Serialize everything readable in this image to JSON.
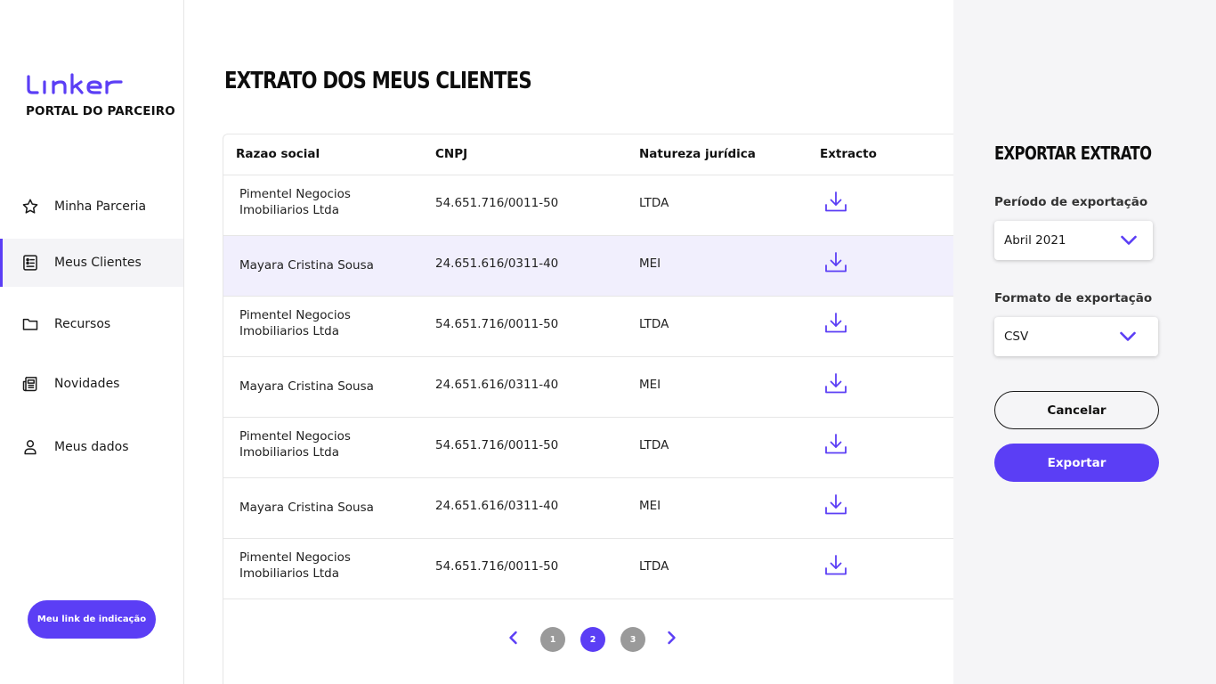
{
  "sidebar": {
    "logo_text": "linker",
    "portal_label": "PORTAL DO PARCEIRO",
    "items": [
      {
        "label": "Minha Parceria",
        "icon": "star-icon"
      },
      {
        "label": "Meus Clientes",
        "icon": "client-list-icon",
        "active": true
      },
      {
        "label": "Recursos",
        "icon": "folder-icon"
      },
      {
        "label": "Novidades",
        "icon": "newspaper-icon"
      },
      {
        "label": "Meus dados",
        "icon": "user-icon"
      }
    ],
    "referral_button": "Meu link de indicação"
  },
  "main": {
    "title": "EXTRATO DOS MEUS CLIENTES",
    "table": {
      "headers": [
        "Razao social",
        "CNPJ",
        "Natureza jurídica",
        "Extracto"
      ],
      "rows": [
        {
          "name": "Pimentel Negocios Imobiliarios Ltda",
          "cnpj": "54.651.716/0011-50",
          "nature": "LTDA"
        },
        {
          "name": "Mayara Cristina Sousa",
          "cnpj": "24.651.616/0311-40",
          "nature": "MEI"
        },
        {
          "name": "Pimentel Negocios Imobiliarios Ltda",
          "cnpj": "54.651.716/0011-50",
          "nature": "LTDA"
        },
        {
          "name": "Mayara Cristina Sousa",
          "cnpj": "24.651.616/0311-40",
          "nature": "MEI"
        },
        {
          "name": "Pimentel Negocios Imobiliarios Ltda",
          "cnpj": "54.651.716/0011-50",
          "nature": "LTDA"
        },
        {
          "name": "Mayara Cristina Sousa",
          "cnpj": "24.651.616/0311-40",
          "nature": "MEI"
        },
        {
          "name": "Pimentel Negocios Imobiliarios Ltda",
          "cnpj": "54.651.716/0011-50",
          "nature": "LTDA"
        }
      ]
    },
    "pagination": {
      "pages": [
        "1",
        "2",
        "3"
      ],
      "current": "2"
    }
  },
  "export_panel": {
    "title": "EXPORTAR EXTRATO",
    "period_label": "Período de exportação",
    "period_value": "Abril 2021",
    "format_label": "Formato de exportação",
    "format_value": "CSV",
    "cancel_label": "Cancelar",
    "export_label": "Exportar"
  },
  "colors": {
    "accent": "#5b3ef5",
    "row_highlight": "#f1effd",
    "panel_bg": "#f5f5f7",
    "page_inactive": "#9a9a9a"
  }
}
